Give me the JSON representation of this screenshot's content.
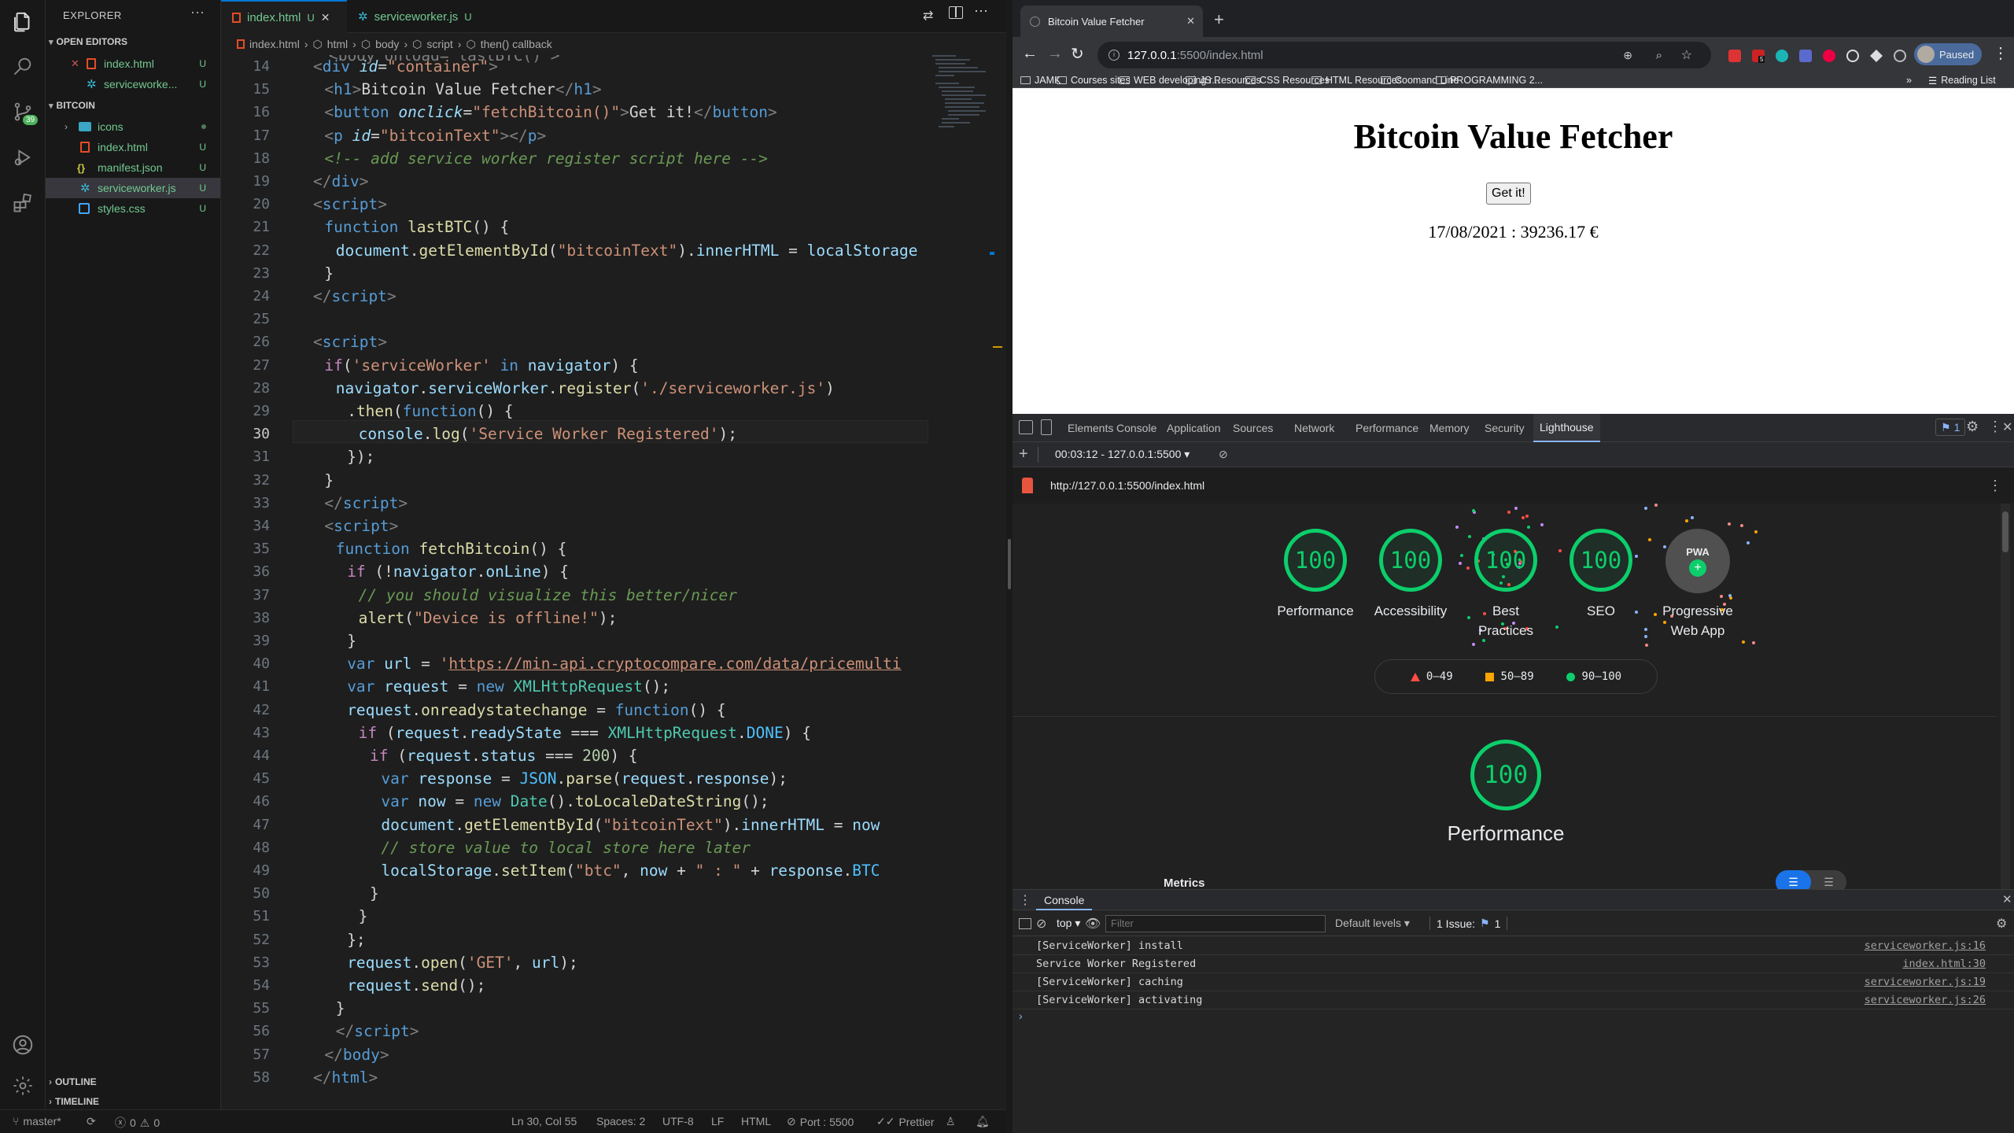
{
  "vscode": {
    "explorer_title": "EXPLORER",
    "open_editors_title": "OPEN EDITORS",
    "open_editors": [
      {
        "name": "index.html",
        "status": "U"
      },
      {
        "name": "serviceworke...",
        "status": "U"
      }
    ],
    "project_title": "BITCOIN",
    "files": [
      {
        "name": "icons",
        "status": ""
      },
      {
        "name": "index.html",
        "status": "U"
      },
      {
        "name": "manifest.json",
        "status": "U"
      },
      {
        "name": "serviceworker.js",
        "status": "U"
      },
      {
        "name": "styles.css",
        "status": "U"
      }
    ],
    "outline_title": "OUTLINE",
    "timeline_title": "TIMELINE",
    "source_control_badge": "39",
    "tabs": [
      {
        "name": "index.html",
        "status": "U"
      },
      {
        "name": "serviceworker.js",
        "status": "U"
      }
    ],
    "breadcrumbs": [
      "index.html",
      "html",
      "body",
      "script",
      "then() callback"
    ],
    "line_numbers": [
      "14",
      "15",
      "16",
      "17",
      "18",
      "19",
      "20",
      "21",
      "22",
      "23",
      "24",
      "25",
      "26",
      "27",
      "28",
      "29",
      "30",
      "31",
      "32",
      "33",
      "34",
      "35",
      "36",
      "37",
      "38",
      "39",
      "40",
      "41",
      "42",
      "43",
      "44",
      "45",
      "46",
      "47",
      "48",
      "49",
      "50",
      "51",
      "52",
      "53",
      "54",
      "55",
      "56",
      "57",
      "58"
    ],
    "top_partial_line": "<body onload=\"lastBTC()\">",
    "status": {
      "branch": "master*",
      "problems": "0",
      "warnings": "0",
      "position": "Ln 30, Col 55",
      "spaces": "Spaces: 2",
      "encoding": "UTF-8",
      "eol": "LF",
      "language": "HTML",
      "port": "Port : 5500",
      "prettier": "Prettier"
    }
  },
  "chrome": {
    "tab_title": "Bitcoin Value Fetcher",
    "url_host": "127.0.0.1",
    "url_rest": ":5500/index.html",
    "profile": "Paused",
    "bookmarks": [
      "JAMK",
      "Courses sites",
      "WEB developing r...",
      "JS Resources",
      "CSS Resources",
      "HTML Resources",
      "Coomand Line",
      "PROGRAMMING 2..."
    ],
    "reading_list": "Reading List",
    "ext_badge": "5"
  },
  "page": {
    "heading": "Bitcoin Value Fetcher",
    "button": "Get it!",
    "value": "17/08/2021 : 39236.17 €"
  },
  "devtools": {
    "tabs": [
      "Elements",
      "Console",
      "Application",
      "Sources",
      "Network",
      "Performance",
      "Memory",
      "Security",
      "Lighthouse"
    ],
    "issues_badge": "1",
    "report_selector": "00:03:12 - 127.0.0.1:5500",
    "report_url": "http://127.0.0.1:5500/index.html",
    "scores": [
      {
        "label": "Performance",
        "score": "100"
      },
      {
        "label": "Accessibility",
        "score": "100"
      },
      {
        "label": "Best Practices",
        "score": "100"
      },
      {
        "label": "SEO",
        "score": "100"
      }
    ],
    "pwa_label": "Progressive Web App",
    "pwa_badge": "PWA",
    "legend": [
      {
        "range": "0–49",
        "color": "#ff4e42"
      },
      {
        "range": "50–89",
        "color": "#ffa400"
      },
      {
        "range": "90–100",
        "color": "#0cce6b"
      }
    ],
    "big_score": "100",
    "big_label": "Performance",
    "metrics_label": "Metrics",
    "console_title": "Console",
    "console_context": "top",
    "console_filter_placeholder": "Filter",
    "console_levels": "Default levels",
    "console_issues": "1 Issue:",
    "console_issue_count": "1",
    "logs": [
      {
        "text": "[ServiceWorker] install",
        "src": "serviceworker.js:16"
      },
      {
        "text": "Service Worker Registered",
        "src": "index.html:30"
      },
      {
        "text": "[ServiceWorker] caching",
        "src": "serviceworker.js:19"
      },
      {
        "text": "[ServiceWorker] activating",
        "src": "serviceworker.js:26"
      }
    ]
  },
  "code": [
    {
      "i": 0,
      "tokens": [
        [
          "<",
          "#808080"
        ],
        [
          "div ",
          "#569cd6"
        ],
        [
          "id",
          "#9cdcfe"
        ],
        [
          "=",
          "#d4d4d4"
        ],
        [
          "\"container\"",
          "#ce9178"
        ],
        [
          ">",
          "#808080"
        ]
      ]
    },
    {
      "i": 1,
      "tokens": [
        [
          "<",
          "#808080"
        ],
        [
          "h1",
          "#569cd6"
        ],
        [
          ">",
          "#808080"
        ],
        [
          "Bitcoin Value Fetcher",
          "#d4d4d4"
        ],
        [
          "</",
          "#808080"
        ],
        [
          "h1",
          "#569cd6"
        ],
        [
          ">",
          "#808080"
        ]
      ]
    },
    {
      "i": 1,
      "tokens": [
        [
          "<",
          "#808080"
        ],
        [
          "button ",
          "#569cd6"
        ],
        [
          "onclick",
          "#9cdcfe"
        ],
        [
          "=",
          "#d4d4d4"
        ],
        [
          "\"fetchBitcoin()\"",
          "#ce9178"
        ],
        [
          ">",
          "#808080"
        ],
        [
          "Get it!",
          "#d4d4d4"
        ],
        [
          "</",
          "#808080"
        ],
        [
          "button",
          "#569cd6"
        ],
        [
          ">",
          "#808080"
        ]
      ]
    },
    {
      "i": 1,
      "tokens": [
        [
          "<",
          "#808080"
        ],
        [
          "p ",
          "#569cd6"
        ],
        [
          "id",
          "#9cdcfe"
        ],
        [
          "=",
          "#d4d4d4"
        ],
        [
          "\"bitcoinText\"",
          "#ce9178"
        ],
        [
          "></",
          "#808080"
        ],
        [
          "p",
          "#569cd6"
        ],
        [
          ">",
          "#808080"
        ]
      ]
    },
    {
      "i": 1,
      "tokens": [
        [
          "<!-- add service worker register script here -->",
          "#6a9955"
        ]
      ]
    },
    {
      "i": 0,
      "tokens": [
        [
          "</",
          "#808080"
        ],
        [
          "div",
          "#569cd6"
        ],
        [
          ">",
          "#808080"
        ]
      ]
    },
    {
      "i": 0,
      "tokens": [
        [
          "<",
          "#808080"
        ],
        [
          "script",
          "#569cd6"
        ],
        [
          ">",
          "#808080"
        ]
      ]
    },
    {
      "i": 1,
      "tokens": [
        [
          "function ",
          "#569cd6"
        ],
        [
          "lastBTC",
          "#dcdcaa"
        ],
        [
          "() {",
          "#d4d4d4"
        ]
      ]
    },
    {
      "i": 2,
      "tokens": [
        [
          "document",
          "#9cdcfe"
        ],
        [
          ".",
          "#d4d4d4"
        ],
        [
          "getElementById",
          "#dcdcaa"
        ],
        [
          "(",
          "#d4d4d4"
        ],
        [
          "\"bitcoinText\"",
          "#ce9178"
        ],
        [
          ").",
          "#d4d4d4"
        ],
        [
          "innerHTML",
          "#9cdcfe"
        ],
        [
          " = ",
          "#d4d4d4"
        ],
        [
          "localStorage",
          "#9cdcfe"
        ]
      ]
    },
    {
      "i": 1,
      "tokens": [
        [
          "}",
          "#d4d4d4"
        ]
      ]
    },
    {
      "i": 0,
      "tokens": [
        [
          "</",
          "#808080"
        ],
        [
          "script",
          "#569cd6"
        ],
        [
          ">",
          "#808080"
        ]
      ]
    },
    {
      "i": 0,
      "tokens": []
    },
    {
      "i": 0,
      "tokens": [
        [
          "<",
          "#808080"
        ],
        [
          "script",
          "#569cd6"
        ],
        [
          ">",
          "#808080"
        ]
      ]
    },
    {
      "i": 1,
      "tokens": [
        [
          "if",
          "#c586c0"
        ],
        [
          "(",
          "#d4d4d4"
        ],
        [
          "'serviceWorker'",
          "#ce9178"
        ],
        [
          " in ",
          "#569cd6"
        ],
        [
          "navigator",
          "#9cdcfe"
        ],
        [
          ") {",
          "#d4d4d4"
        ]
      ]
    },
    {
      "i": 2,
      "tokens": [
        [
          "navigator",
          "#9cdcfe"
        ],
        [
          ".",
          "#d4d4d4"
        ],
        [
          "serviceWorker",
          "#9cdcfe"
        ],
        [
          ".",
          "#d4d4d4"
        ],
        [
          "register",
          "#dcdcaa"
        ],
        [
          "(",
          "#d4d4d4"
        ],
        [
          "'./serviceworker.js'",
          "#ce9178"
        ],
        [
          ")",
          "#d4d4d4"
        ]
      ]
    },
    {
      "i": 3,
      "tokens": [
        [
          ".",
          "#d4d4d4"
        ],
        [
          "then",
          "#dcdcaa"
        ],
        [
          "(",
          "#d4d4d4"
        ],
        [
          "function",
          "#569cd6"
        ],
        [
          "() {",
          "#d4d4d4"
        ]
      ]
    },
    {
      "i": 4,
      "tokens": [
        [
          "console",
          "#9cdcfe"
        ],
        [
          ".",
          "#d4d4d4"
        ],
        [
          "log",
          "#dcdcaa"
        ],
        [
          "(",
          "#d4d4d4"
        ],
        [
          "'Service Worker Registered'",
          "#ce9178"
        ],
        [
          ");",
          "#d4d4d4"
        ]
      ]
    },
    {
      "i": 3,
      "tokens": [
        [
          "});",
          "#d4d4d4"
        ]
      ]
    },
    {
      "i": 1,
      "tokens": [
        [
          "}",
          "#d4d4d4"
        ]
      ]
    },
    {
      "i": 1,
      "tokens": [
        [
          "</",
          "#808080"
        ],
        [
          "script",
          "#569cd6"
        ],
        [
          ">",
          "#808080"
        ]
      ]
    },
    {
      "i": 1,
      "tokens": [
        [
          "<",
          "#808080"
        ],
        [
          "script",
          "#569cd6"
        ],
        [
          ">",
          "#808080"
        ]
      ]
    },
    {
      "i": 2,
      "tokens": [
        [
          "function ",
          "#569cd6"
        ],
        [
          "fetchBitcoin",
          "#dcdcaa"
        ],
        [
          "() {",
          "#d4d4d4"
        ]
      ]
    },
    {
      "i": 3,
      "tokens": [
        [
          "if ",
          "#c586c0"
        ],
        [
          "(!",
          "#d4d4d4"
        ],
        [
          "navigator",
          "#9cdcfe"
        ],
        [
          ".",
          "#d4d4d4"
        ],
        [
          "onLine",
          "#9cdcfe"
        ],
        [
          ") {",
          "#d4d4d4"
        ]
      ]
    },
    {
      "i": 4,
      "tokens": [
        [
          "// you should visualize this better/nicer",
          "#6a9955"
        ]
      ]
    },
    {
      "i": 4,
      "tokens": [
        [
          "alert",
          "#dcdcaa"
        ],
        [
          "(",
          "#d4d4d4"
        ],
        [
          "\"Device is offline!\"",
          "#ce9178"
        ],
        [
          ");",
          "#d4d4d4"
        ]
      ]
    },
    {
      "i": 3,
      "tokens": [
        [
          "}",
          "#d4d4d4"
        ]
      ]
    },
    {
      "i": 3,
      "tokens": [
        [
          "var ",
          "#569cd6"
        ],
        [
          "url",
          "#9cdcfe"
        ],
        [
          " = ",
          "#d4d4d4"
        ],
        [
          "'",
          "#ce9178"
        ],
        [
          "https://min-api.cryptocompare.com/data/pricemulti",
          "#ce9178"
        ]
      ]
    },
    {
      "i": 3,
      "tokens": [
        [
          "var ",
          "#569cd6"
        ],
        [
          "request",
          "#9cdcfe"
        ],
        [
          " = ",
          "#d4d4d4"
        ],
        [
          "new ",
          "#569cd6"
        ],
        [
          "XMLHttpRequest",
          "#4ec9b0"
        ],
        [
          "();",
          "#d4d4d4"
        ]
      ]
    },
    {
      "i": 3,
      "tokens": [
        [
          "request",
          "#9cdcfe"
        ],
        [
          ".",
          "#d4d4d4"
        ],
        [
          "onreadystatechange",
          "#dcdcaa"
        ],
        [
          " = ",
          "#d4d4d4"
        ],
        [
          "function",
          "#569cd6"
        ],
        [
          "() {",
          "#d4d4d4"
        ]
      ]
    },
    {
      "i": 4,
      "tokens": [
        [
          "if ",
          "#c586c0"
        ],
        [
          "(",
          "#d4d4d4"
        ],
        [
          "request",
          "#9cdcfe"
        ],
        [
          ".",
          "#d4d4d4"
        ],
        [
          "readyState",
          "#9cdcfe"
        ],
        [
          " === ",
          "#d4d4d4"
        ],
        [
          "XMLHttpRequest",
          "#4ec9b0"
        ],
        [
          ".",
          "#d4d4d4"
        ],
        [
          "DONE",
          "#4fc1ff"
        ],
        [
          ") {",
          "#d4d4d4"
        ]
      ]
    },
    {
      "i": 5,
      "tokens": [
        [
          "if ",
          "#c586c0"
        ],
        [
          "(",
          "#d4d4d4"
        ],
        [
          "request",
          "#9cdcfe"
        ],
        [
          ".",
          "#d4d4d4"
        ],
        [
          "status",
          "#9cdcfe"
        ],
        [
          " === ",
          "#d4d4d4"
        ],
        [
          "200",
          "#b5cea8"
        ],
        [
          ") {",
          "#d4d4d4"
        ]
      ]
    },
    {
      "i": 6,
      "tokens": [
        [
          "var ",
          "#569cd6"
        ],
        [
          "response",
          "#9cdcfe"
        ],
        [
          " = ",
          "#d4d4d4"
        ],
        [
          "JSON",
          "#4fc1ff"
        ],
        [
          ".",
          "#d4d4d4"
        ],
        [
          "parse",
          "#dcdcaa"
        ],
        [
          "(",
          "#d4d4d4"
        ],
        [
          "request",
          "#9cdcfe"
        ],
        [
          ".",
          "#d4d4d4"
        ],
        [
          "response",
          "#9cdcfe"
        ],
        [
          ");",
          "#d4d4d4"
        ]
      ]
    },
    {
      "i": 6,
      "tokens": [
        [
          "var ",
          "#569cd6"
        ],
        [
          "now",
          "#9cdcfe"
        ],
        [
          " = ",
          "#d4d4d4"
        ],
        [
          "new ",
          "#569cd6"
        ],
        [
          "Date",
          "#4ec9b0"
        ],
        [
          "().",
          "#d4d4d4"
        ],
        [
          "toLocaleDateString",
          "#dcdcaa"
        ],
        [
          "();",
          "#d4d4d4"
        ]
      ]
    },
    {
      "i": 6,
      "tokens": [
        [
          "document",
          "#9cdcfe"
        ],
        [
          ".",
          "#d4d4d4"
        ],
        [
          "getElementById",
          "#dcdcaa"
        ],
        [
          "(",
          "#d4d4d4"
        ],
        [
          "\"bitcoinText\"",
          "#ce9178"
        ],
        [
          ").",
          "#d4d4d4"
        ],
        [
          "innerHTML",
          "#9cdcfe"
        ],
        [
          " = ",
          "#d4d4d4"
        ],
        [
          "now",
          "#9cdcfe"
        ]
      ]
    },
    {
      "i": 6,
      "tokens": [
        [
          "// store value to local store here later",
          "#6a9955"
        ]
      ]
    },
    {
      "i": 6,
      "tokens": [
        [
          "localStorage",
          "#9cdcfe"
        ],
        [
          ".",
          "#d4d4d4"
        ],
        [
          "setItem",
          "#dcdcaa"
        ],
        [
          "(",
          "#d4d4d4"
        ],
        [
          "\"btc\"",
          "#ce9178"
        ],
        [
          ", ",
          "#d4d4d4"
        ],
        [
          "now",
          "#9cdcfe"
        ],
        [
          " + ",
          "#d4d4d4"
        ],
        [
          "\" : \"",
          "#ce9178"
        ],
        [
          " + ",
          "#d4d4d4"
        ],
        [
          "response",
          "#9cdcfe"
        ],
        [
          ".",
          "#d4d4d4"
        ],
        [
          "BTC",
          "#4fc1ff"
        ]
      ]
    },
    {
      "i": 5,
      "tokens": [
        [
          "}",
          "#d4d4d4"
        ]
      ]
    },
    {
      "i": 4,
      "tokens": [
        [
          "}",
          "#d4d4d4"
        ]
      ]
    },
    {
      "i": 3,
      "tokens": [
        [
          "};",
          "#d4d4d4"
        ]
      ]
    },
    {
      "i": 3,
      "tokens": [
        [
          "request",
          "#9cdcfe"
        ],
        [
          ".",
          "#d4d4d4"
        ],
        [
          "open",
          "#dcdcaa"
        ],
        [
          "(",
          "#d4d4d4"
        ],
        [
          "'GET'",
          "#ce9178"
        ],
        [
          ", ",
          "#d4d4d4"
        ],
        [
          "url",
          "#9cdcfe"
        ],
        [
          ");",
          "#d4d4d4"
        ]
      ]
    },
    {
      "i": 3,
      "tokens": [
        [
          "request",
          "#9cdcfe"
        ],
        [
          ".",
          "#d4d4d4"
        ],
        [
          "send",
          "#dcdcaa"
        ],
        [
          "();",
          "#d4d4d4"
        ]
      ]
    },
    {
      "i": 2,
      "tokens": [
        [
          "}",
          "#d4d4d4"
        ]
      ]
    },
    {
      "i": 2,
      "tokens": [
        [
          "</",
          "#808080"
        ],
        [
          "script",
          "#569cd6"
        ],
        [
          ">",
          "#808080"
        ]
      ]
    },
    {
      "i": 1,
      "tokens": [
        [
          "</",
          "#808080"
        ],
        [
          "body",
          "#569cd6"
        ],
        [
          ">",
          "#808080"
        ]
      ]
    },
    {
      "i": 0,
      "tokens": [
        [
          "</",
          "#808080"
        ],
        [
          "html",
          "#569cd6"
        ],
        [
          ">",
          "#808080"
        ]
      ]
    }
  ]
}
